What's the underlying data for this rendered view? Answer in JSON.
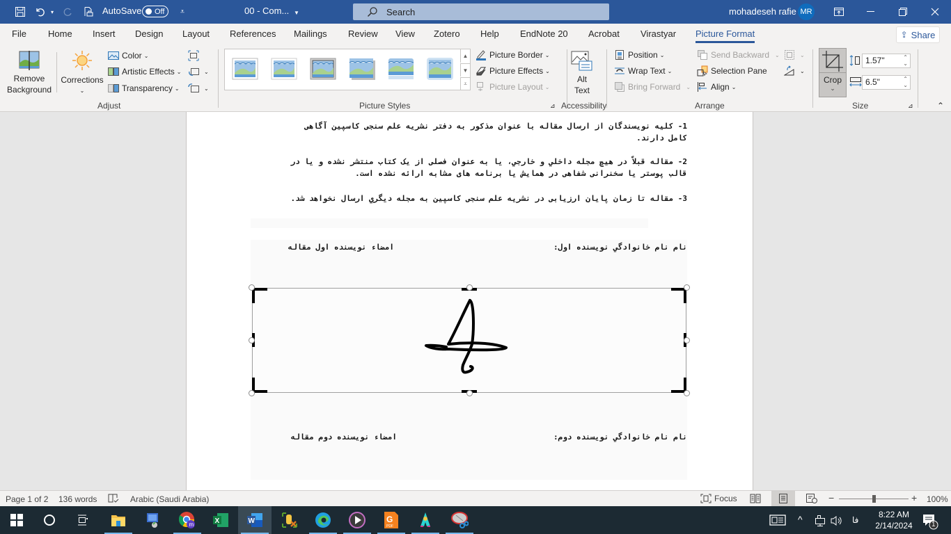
{
  "titlebar": {
    "autosave_label": "AutoSave",
    "autosave_state": "Off",
    "doc_title": "00 - Com...",
    "search_placeholder": "Search",
    "user_name": "mohadeseh rafie",
    "user_initials": "MR",
    "icons": [
      "save-icon",
      "undo-icon",
      "redo-icon",
      "print-preview-icon",
      "customize-qat-icon",
      "ribbon-display-icon",
      "minimize-icon",
      "restore-icon",
      "close-icon"
    ]
  },
  "tabs": [
    {
      "label": "File"
    },
    {
      "label": "Home"
    },
    {
      "label": "Insert"
    },
    {
      "label": "Design"
    },
    {
      "label": "Layout"
    },
    {
      "label": "References"
    },
    {
      "label": "Mailings"
    },
    {
      "label": "Review"
    },
    {
      "label": "View"
    },
    {
      "label": "Zotero"
    },
    {
      "label": "Help"
    },
    {
      "label": "EndNote 20"
    },
    {
      "label": "Acrobat"
    },
    {
      "label": "Virastyar"
    },
    {
      "label": "Picture Format",
      "active": true
    }
  ],
  "share_label": "Share",
  "ribbon": {
    "adjust": {
      "label": "Adjust",
      "remove_bg_line1": "Remove",
      "remove_bg_line2": "Background",
      "corrections": "Corrections",
      "color": "Color",
      "artistic_effects": "Artistic Effects",
      "transparency": "Transparency"
    },
    "styles": {
      "label": "Picture Styles",
      "picture_border": "Picture Border",
      "picture_effects": "Picture Effects",
      "picture_layout": "Picture Layout"
    },
    "accessibility": {
      "label": "Accessibility",
      "alt_line1": "Alt",
      "alt_line2": "Text"
    },
    "arrange": {
      "label": "Arrange",
      "position": "Position",
      "wrap_text": "Wrap Text",
      "bring_forward": "Bring Forward",
      "send_backward": "Send Backward",
      "selection_pane": "Selection Pane",
      "align": "Align"
    },
    "size": {
      "label": "Size",
      "crop": "Crop",
      "height": "1.57\"",
      "width": "6.5\""
    }
  },
  "document": {
    "para1_line1": "1- کلیه نویسندگان از ارسال مقاله با عنوان مذکور به دفتر نشریه علم سنجی کاسپین آگاهی",
    "para1_line2": "کامل دارند.",
    "para2_line1": "2- مقاله قبلاً در هیچ مجله داخلي و خارجي، يا به عنوان فصلی از یک کتاب منتشر نشده و يا در",
    "para2_line2": "قالب پوستر يا سخنرانی شفاهی در همایش يا برنامه های مشابه ارائه نشده است.",
    "para3": "3- مقاله تا زمان پایان ارزیابی در نشریه علم سنجی کاسپین به مجله ديگري ارسال نخواهد شد.",
    "author1_name_label": "نام نام خانوادگي نويسنده اول:",
    "author1_sign_label": "امضاء نویسنده اول مقاله",
    "author2_name_label": "نام نام خانوادگي نويسنده دوم:",
    "author2_sign_label": "امضاء نویسنده دوم مقاله"
  },
  "statusbar": {
    "page": "Page 1 of 2",
    "words": "136 words",
    "language": "Arabic (Saudi Arabia)",
    "focus": "Focus",
    "zoom_level": "100%",
    "zoom_fraction": 0.5
  },
  "taskbar": {
    "apps": [
      "start",
      "cortana",
      "task-view",
      "file-explorer",
      "remote-desktop",
      "chrome",
      "excel",
      "word",
      "app-tool",
      "edge",
      "media-player",
      "pdf-app",
      "app-figure",
      "snipping-tool"
    ],
    "active_app": "word",
    "time": "8:22 AM",
    "date": "2/14/2024",
    "input_lang": "فا",
    "notifications": "1"
  }
}
